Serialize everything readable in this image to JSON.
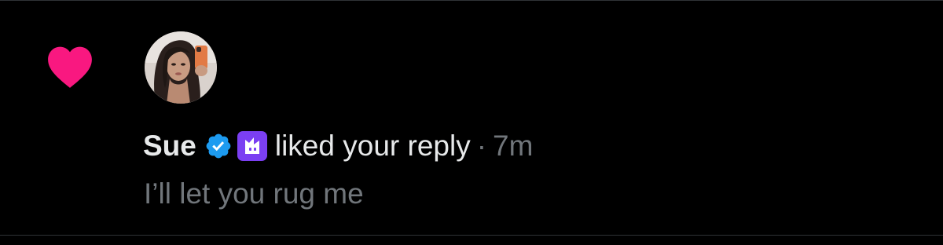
{
  "notification": {
    "user_name": "Sue",
    "action": "liked your reply",
    "separator": "·",
    "time": "7m",
    "reply_text": "I’ll let you rug me",
    "icons": {
      "type": "heart-icon",
      "verified": "verified-badge-icon",
      "affiliate": "affiliate-badge-icon"
    }
  },
  "colors": {
    "background": "#000000",
    "heart": "#f91880",
    "verified": "#1d9bf0",
    "affiliate": "#7b3ff2",
    "primary_text": "#e7e9ea",
    "secondary_text": "#71767b",
    "divider": "#2f3336"
  }
}
